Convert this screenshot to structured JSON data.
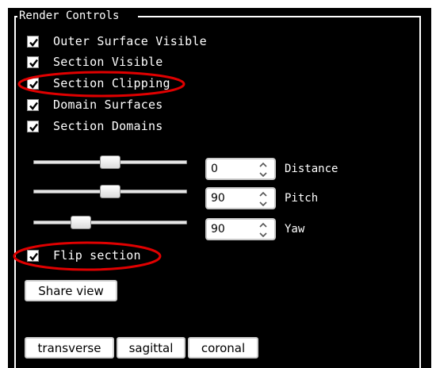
{
  "panel": {
    "legend": "Render Controls",
    "checkboxes": [
      {
        "label": "Outer Surface Visible",
        "checked": true
      },
      {
        "label": "Section Visible",
        "checked": true
      },
      {
        "label": "Section Clipping",
        "checked": true
      },
      {
        "label": "Domain Surfaces",
        "checked": true
      },
      {
        "label": "Section Domains",
        "checked": true
      }
    ],
    "controls": [
      {
        "label": "Distance",
        "value": "0",
        "slider_position": 0.5
      },
      {
        "label": "Pitch",
        "value": "90",
        "slider_position": 0.5
      },
      {
        "label": "Yaw",
        "value": "90",
        "slider_position": 0.28
      }
    ],
    "flip": {
      "label": "Flip section",
      "checked": true
    },
    "share_button": "Share view",
    "view_buttons": [
      "transverse",
      "sagittal",
      "coronal"
    ]
  },
  "annotations": {
    "highlight_color": "#e00000",
    "highlighted": [
      "Section Clipping",
      "Flip section"
    ]
  },
  "colors": {
    "panel_background": "#000000",
    "text": "#ffffff"
  }
}
